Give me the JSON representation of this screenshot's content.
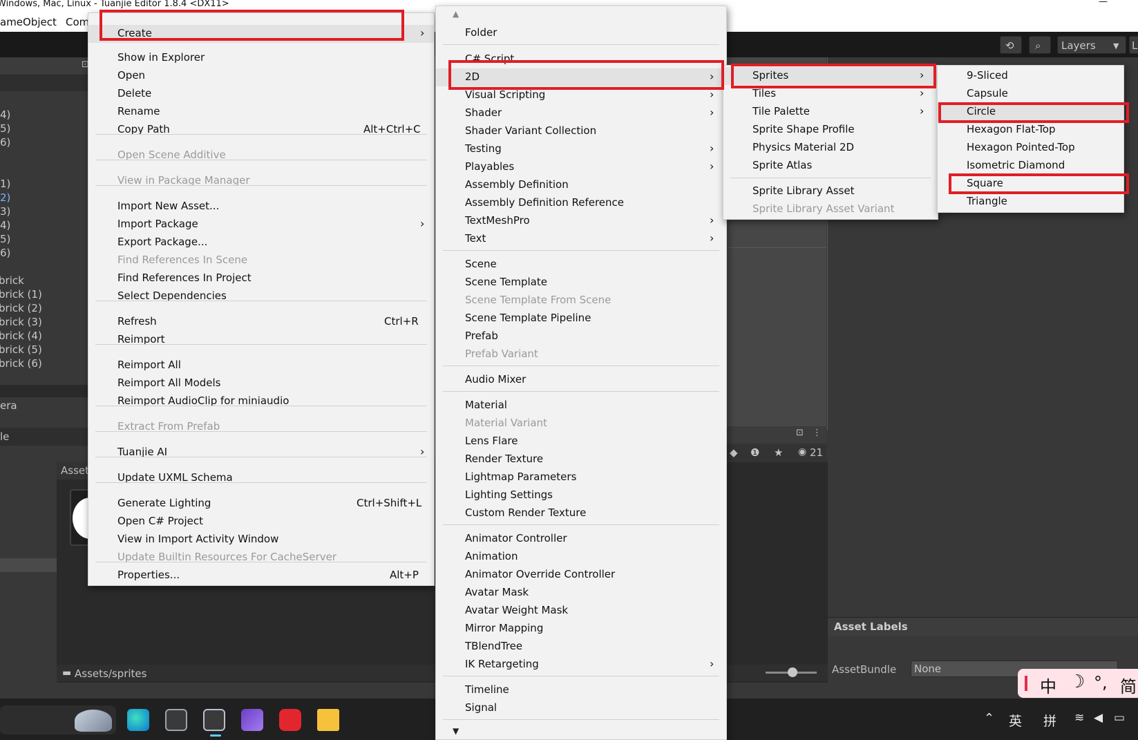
{
  "window": {
    "title": "Windows, Mac, Linux - Tuanjie Editor 1.8.4 <DX11>",
    "minimize": "—"
  },
  "menubar": [
    "ameObject",
    "Com"
  ],
  "toolbar": {
    "layers_label": "Layers",
    "layout_label": "L"
  },
  "hierarchy": {
    "group_a": [
      "4)",
      "5)",
      "6)"
    ],
    "group_b": [
      "1)",
      "2)",
      "3)",
      "4)",
      "5)",
      "6)"
    ],
    "group_c": [
      "brick",
      "brick (1)",
      "brick (2)",
      "brick (3)",
      "brick (4)",
      "brick (5)",
      "brick (6)"
    ],
    "camera_label": "era",
    "console_label": "le"
  },
  "project": {
    "assets_tab": "Asset",
    "path": "Assets/sprites",
    "count_badge": "21"
  },
  "inspector": {
    "asset_labels": "Asset Labels",
    "assetbundle_label": "AssetBundle",
    "assetbundle_value": "None"
  },
  "ime": {
    "items": [
      "中",
      "☽",
      "°,",
      "简"
    ]
  },
  "tray": {
    "lang": "英",
    "input": "拼"
  },
  "menu_main": {
    "items": [
      {
        "label": "Create",
        "arrow": "›"
      },
      {
        "label": "Show in Explorer"
      },
      {
        "label": "Open"
      },
      {
        "label": "Delete"
      },
      {
        "label": "Rename"
      },
      {
        "label": "Copy Path",
        "shortcut": "Alt+Ctrl+C"
      },
      {
        "label": "Open Scene Additive"
      },
      {
        "label": "View in Package Manager"
      },
      {
        "label": "Import New Asset..."
      },
      {
        "label": "Import Package",
        "arrow": "›"
      },
      {
        "label": "Export Package..."
      },
      {
        "label": "Find References In Scene"
      },
      {
        "label": "Find References In Project"
      },
      {
        "label": "Select Dependencies"
      },
      {
        "label": "Refresh",
        "shortcut": "Ctrl+R"
      },
      {
        "label": "Reimport"
      },
      {
        "label": "Reimport All"
      },
      {
        "label": "Reimport All Models"
      },
      {
        "label": "Reimport AudioClip for miniaudio"
      },
      {
        "label": "Extract From Prefab"
      },
      {
        "label": "Tuanjie AI",
        "arrow": "›"
      },
      {
        "label": "Update UXML Schema"
      },
      {
        "label": "Generate Lighting",
        "shortcut": "Ctrl+Shift+L"
      },
      {
        "label": "Open C# Project"
      },
      {
        "label": "View in Import Activity Window"
      },
      {
        "label": "Update Builtin Resources For CacheServer"
      },
      {
        "label": "Properties...",
        "shortcut": "Alt+P"
      }
    ]
  },
  "menu_create": {
    "scroll_up": "▲",
    "scroll_down": "▼",
    "items": [
      {
        "label": "Folder"
      },
      {
        "label": "C# Script"
      },
      {
        "label": "2D",
        "arrow": "›"
      },
      {
        "label": "Visual Scripting",
        "arrow": "›"
      },
      {
        "label": "Shader",
        "arrow": "›"
      },
      {
        "label": "Shader Variant Collection"
      },
      {
        "label": "Testing",
        "arrow": "›"
      },
      {
        "label": "Playables",
        "arrow": "›"
      },
      {
        "label": "Assembly Definition"
      },
      {
        "label": "Assembly Definition Reference"
      },
      {
        "label": "TextMeshPro",
        "arrow": "›"
      },
      {
        "label": "Text",
        "arrow": "›"
      },
      {
        "label": "Scene"
      },
      {
        "label": "Scene Template"
      },
      {
        "label": "Scene Template From Scene"
      },
      {
        "label": "Scene Template Pipeline"
      },
      {
        "label": "Prefab"
      },
      {
        "label": "Prefab Variant"
      },
      {
        "label": "Audio Mixer"
      },
      {
        "label": "Material"
      },
      {
        "label": "Material Variant"
      },
      {
        "label": "Lens Flare"
      },
      {
        "label": "Render Texture"
      },
      {
        "label": "Lightmap Parameters"
      },
      {
        "label": "Lighting Settings"
      },
      {
        "label": "Custom Render Texture"
      },
      {
        "label": "Animator Controller"
      },
      {
        "label": "Animation"
      },
      {
        "label": "Animator Override Controller"
      },
      {
        "label": "Avatar Mask"
      },
      {
        "label": "Avatar Weight Mask"
      },
      {
        "label": "Mirror Mapping"
      },
      {
        "label": "TBlendTree"
      },
      {
        "label": "IK Retargeting",
        "arrow": "›"
      },
      {
        "label": "Timeline"
      },
      {
        "label": "Signal"
      }
    ]
  },
  "menu_2d": {
    "items": [
      {
        "label": "Sprites",
        "arrow": "›"
      },
      {
        "label": "Tiles",
        "arrow": "›"
      },
      {
        "label": "Tile Palette",
        "arrow": "›"
      },
      {
        "label": "Sprite Shape Profile"
      },
      {
        "label": "Physics Material 2D"
      },
      {
        "label": "Sprite Atlas"
      },
      {
        "label": "Sprite Library Asset"
      },
      {
        "label": "Sprite Library Asset Variant"
      }
    ]
  },
  "menu_sprites": {
    "items": [
      {
        "label": "9-Sliced"
      },
      {
        "label": "Capsule"
      },
      {
        "label": "Circle"
      },
      {
        "label": "Hexagon Flat-Top"
      },
      {
        "label": "Hexagon Pointed-Top"
      },
      {
        "label": "Isometric Diamond"
      },
      {
        "label": "Square"
      },
      {
        "label": "Triangle"
      }
    ]
  },
  "colors": {
    "highlight_box": "#e01e26",
    "menu_bg": "#f2f2f2",
    "editor_bg": "#383838"
  }
}
